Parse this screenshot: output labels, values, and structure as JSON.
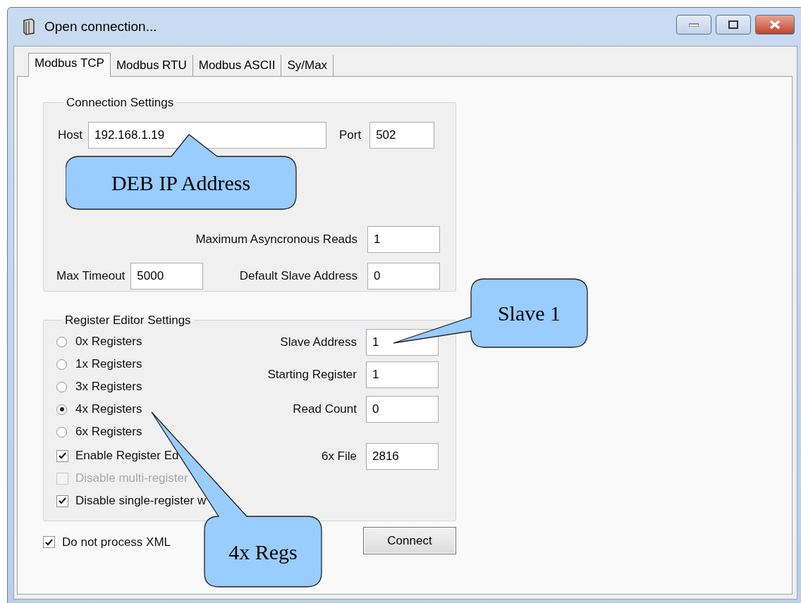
{
  "window": {
    "title": "Open connection..."
  },
  "tabs": [
    {
      "label": "Modbus TCP",
      "selected": true
    },
    {
      "label": "Modbus RTU",
      "selected": false
    },
    {
      "label": "Modbus ASCII",
      "selected": false
    },
    {
      "label": "Sy/Max",
      "selected": false
    }
  ],
  "connection_settings": {
    "title": "Connection Settings",
    "host": {
      "label": "Host",
      "value": "192.168.1.19"
    },
    "port": {
      "label": "Port",
      "value": "502"
    },
    "max_async_reads": {
      "label": "Maximum Asyncronous Reads",
      "value": "1"
    },
    "max_timeout": {
      "label": "Max Timeout",
      "value": "5000"
    },
    "default_slave_address": {
      "label": "Default Slave Address",
      "value": "0"
    }
  },
  "register_editor_settings": {
    "title": "Register Editor Settings",
    "registers": [
      {
        "label": "0x Registers",
        "selected": false
      },
      {
        "label": "1x Registers",
        "selected": false
      },
      {
        "label": "3x Registers",
        "selected": false
      },
      {
        "label": "4x Registers",
        "selected": true
      },
      {
        "label": "6x Registers",
        "selected": false
      }
    ],
    "fields": [
      {
        "label": "Slave Address",
        "value": "1"
      },
      {
        "label": "Starting Register",
        "value": "1"
      },
      {
        "label": "Read Count",
        "value": "0"
      },
      {
        "label": "6x File",
        "value": "2816"
      }
    ],
    "options": [
      {
        "label": "Enable Register Ed",
        "checked": true,
        "disabled": false
      },
      {
        "label": "Disable multi-register",
        "checked": false,
        "disabled": true
      },
      {
        "label": "Disable single-register w",
        "checked": true,
        "disabled": false
      }
    ]
  },
  "do_not_process_xml": {
    "label": "Do not process XML",
    "checked": true
  },
  "connect_button": "Connect",
  "callouts": [
    {
      "text": "DEB IP Address"
    },
    {
      "text": "Slave 1"
    },
    {
      "text": "4x Regs"
    }
  ]
}
